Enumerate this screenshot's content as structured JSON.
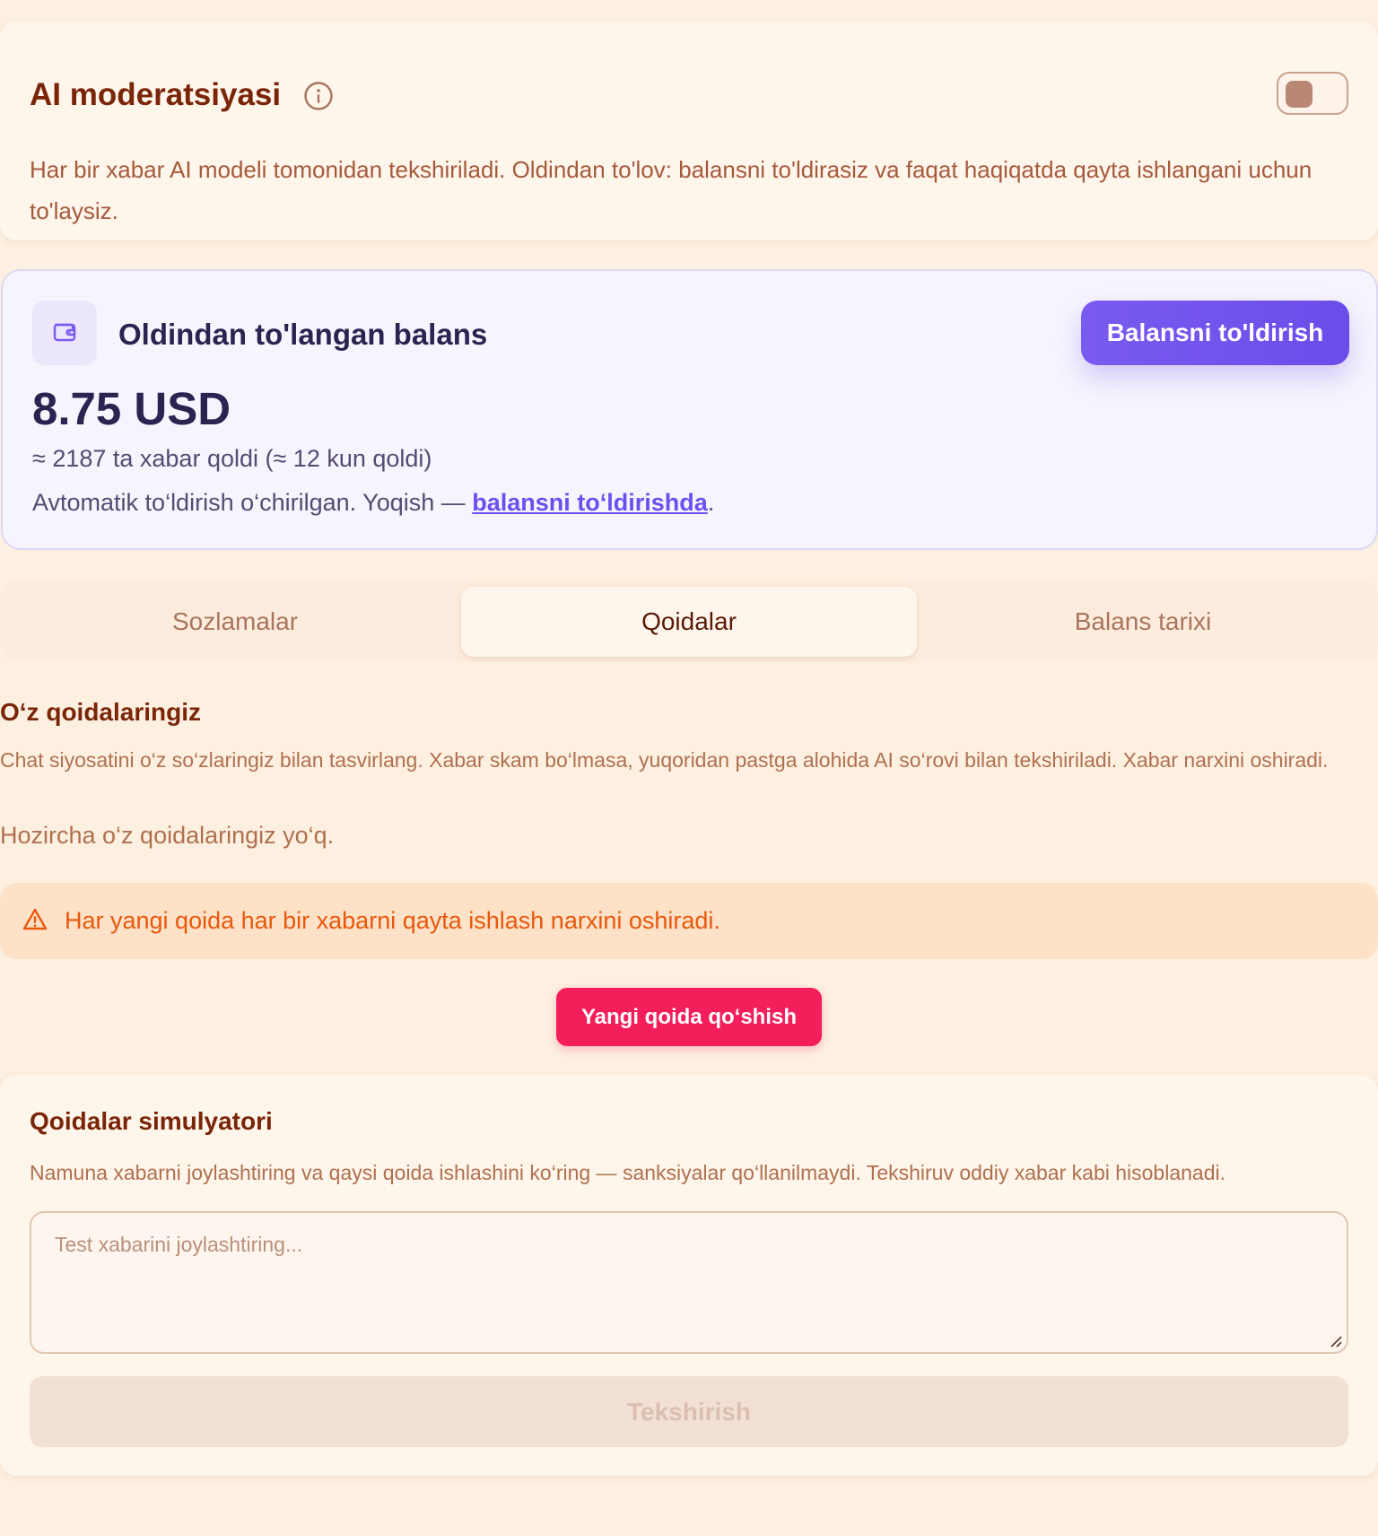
{
  "moderation": {
    "title": "AI moderatsiyasi",
    "description": "Har bir xabar AI modeli tomonidan tekshiriladi. Oldindan to'lov: balansni to'ldirasiz va faqat haqiqatda qayta ishlangani uchun to'laysiz.",
    "toggle_enabled": false,
    "info_icon": "info-circle-icon"
  },
  "balance": {
    "title": "Oldindan to'langan balans",
    "amount": "8.75 USD",
    "remaining": "≈ 2187 ta xabar qoldi (≈ 12 kun qoldi)",
    "auto_topup_prefix": "Avtomatik to‘ldirish o‘chirilgan. Yoqish — ",
    "auto_topup_link": "balansni to‘ldirishda",
    "auto_topup_suffix": ".",
    "topup_button": "Balansni to'ldirish",
    "wallet_icon": "wallet-icon",
    "accent_color": "#6d4ff0"
  },
  "tabs": [
    {
      "label": "Sozlamalar",
      "active": false
    },
    {
      "label": "Qoidalar",
      "active": true
    },
    {
      "label": "Balans tarixi",
      "active": false
    }
  ],
  "rules": {
    "title": "O‘z qoidalaringiz",
    "description": "Chat siyosatini o‘z so‘zlaringiz bilan tasvirlang. Xabar skam bo‘lmasa, yuqoridan pastga alohida AI so‘rovi bilan tekshiriladi. Xabar narxini oshiradi.",
    "empty_text": "Hozircha o‘z qoidalaringiz yo‘q.",
    "warning": "Har yangi qoida har bir xabarni qayta ishlash narxini oshiradi.",
    "warning_icon": "warning-triangle-icon",
    "add_button": "Yangi qoida qo‘shish",
    "add_button_color": "#f41e5a"
  },
  "simulator": {
    "title": "Qoidalar simulyatori",
    "description": "Namuna xabarni joylashtiring va qaysi qoida ishlashini ko‘ring — sanksiyalar qo‘llanilmaydi. Tekshiruv oddiy xabar kabi hisoblanadi.",
    "input_value": "",
    "input_placeholder": "Test xabarini joylashtiring...",
    "check_button": "Tekshirish",
    "check_button_disabled": true
  }
}
